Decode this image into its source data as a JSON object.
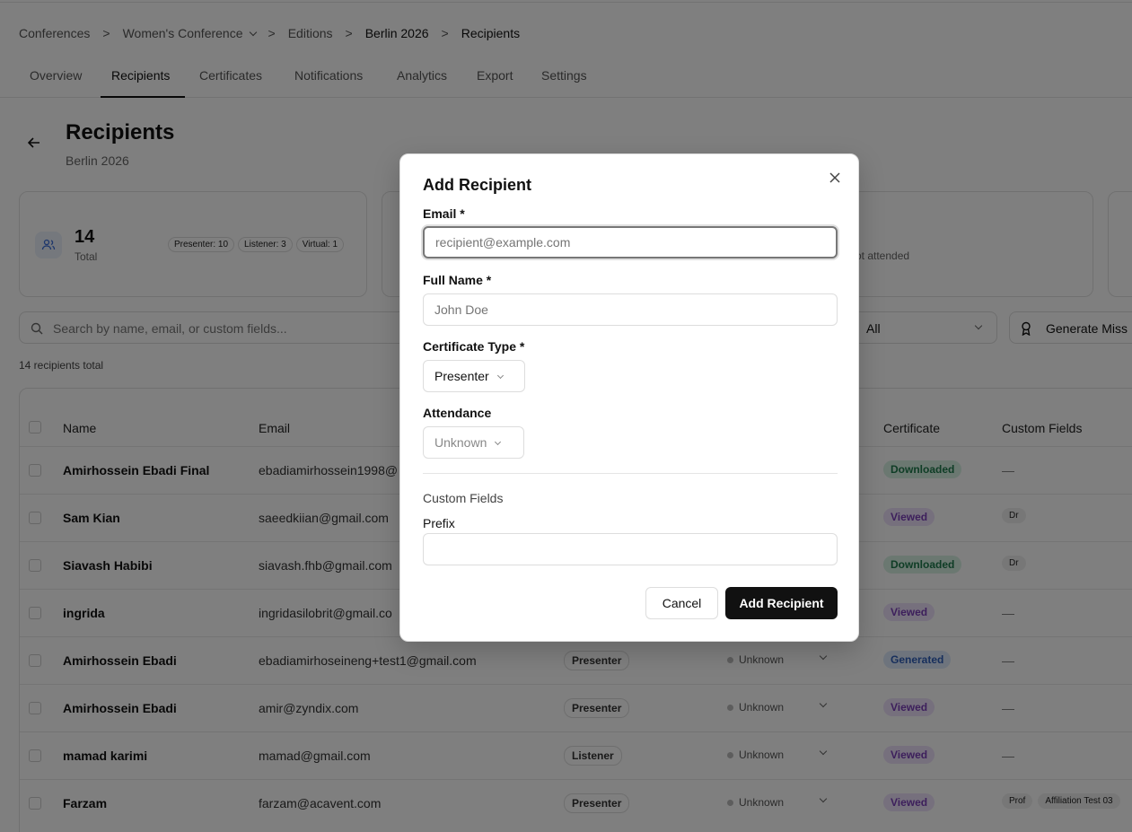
{
  "breadcrumb": {
    "items": [
      "Conferences",
      "Women's Conference",
      "Editions",
      "Berlin 2026",
      "Recipients"
    ],
    "separator": ">"
  },
  "tabs": [
    "Overview",
    "Recipients",
    "Certificates",
    "Notifications",
    "Analytics",
    "Export",
    "Settings"
  ],
  "active_tab": "Recipients",
  "page": {
    "title": "Recipients",
    "subtitle": "Berlin 2026",
    "back_icon": "arrow-left-icon"
  },
  "stats": {
    "total_value": "14",
    "total_label": "Total",
    "pills": [
      "Presenter: 10",
      "Listener: 3",
      "Virtual: 1"
    ],
    "partial_label": "ot attended"
  },
  "toolbar": {
    "search_placeholder": "Search by name, email, or custom fields...",
    "filter_value": "All",
    "generate_label": "Generate Miss"
  },
  "total_text": "14 recipients total",
  "table": {
    "headers": [
      "Name",
      "Email",
      "Certificate",
      "Custom Fields"
    ],
    "rows": [
      {
        "name": "Amirhossein Ebadi Final",
        "email": "ebadiamirhossein1998@",
        "type": "",
        "attendance": "",
        "certificate": "Downloaded",
        "custom": []
      },
      {
        "name": "Sam Kian",
        "email": "saeedkiian@gmail.com",
        "type": "",
        "attendance": "",
        "certificate": "Viewed",
        "custom": [
          "Dr"
        ]
      },
      {
        "name": "Siavash Habibi",
        "email": "siavash.fhb@gmail.com",
        "type": "",
        "attendance": "",
        "certificate": "Downloaded",
        "custom": [
          "Dr"
        ]
      },
      {
        "name": "ingrida",
        "email": "ingridasilobrit@gmail.co",
        "type": "",
        "attendance": "",
        "certificate": "Viewed",
        "custom": []
      },
      {
        "name": "Amirhossein Ebadi",
        "email": "ebadiamirhoseineng+test1@gmail.com",
        "type": "Presenter",
        "attendance": "Unknown",
        "certificate": "Generated",
        "custom": []
      },
      {
        "name": "Amirhossein Ebadi",
        "email": "amir@zyndix.com",
        "type": "Presenter",
        "attendance": "Unknown",
        "certificate": "Viewed",
        "custom": []
      },
      {
        "name": "mamad karimi",
        "email": "mamad@gmail.com",
        "type": "Listener",
        "attendance": "Unknown",
        "certificate": "Viewed",
        "custom": []
      },
      {
        "name": "Farzam",
        "email": "farzam@acavent.com",
        "type": "Presenter",
        "attendance": "Unknown",
        "certificate": "Viewed",
        "custom": [
          "Prof",
          "Affiliation Test 03"
        ]
      }
    ],
    "empty_custom": "—"
  },
  "modal": {
    "title": "Add Recipient",
    "email_label": "Email *",
    "email_placeholder": "recipient@example.com",
    "email_value": "",
    "name_label": "Full Name *",
    "name_placeholder": "John Doe",
    "name_value": "",
    "cert_type_label": "Certificate Type *",
    "cert_type_value": "Presenter",
    "attendance_label": "Attendance",
    "attendance_value": "Unknown",
    "custom_fields_label": "Custom Fields",
    "prefix_label": "Prefix",
    "prefix_value": "",
    "cancel_label": "Cancel",
    "submit_label": "Add Recipient",
    "close_icon": "close-icon"
  },
  "colors": {
    "downloaded_bg": "#d6f0e2",
    "downloaded_fg": "#1e7a4c",
    "viewed_bg": "#ede0fa",
    "viewed_fg": "#7a3fb8",
    "generated_bg": "#dde8fb",
    "generated_fg": "#2f5fb8",
    "overlay": "rgba(0,0,0,0.5)",
    "primary_button": "#111111"
  }
}
